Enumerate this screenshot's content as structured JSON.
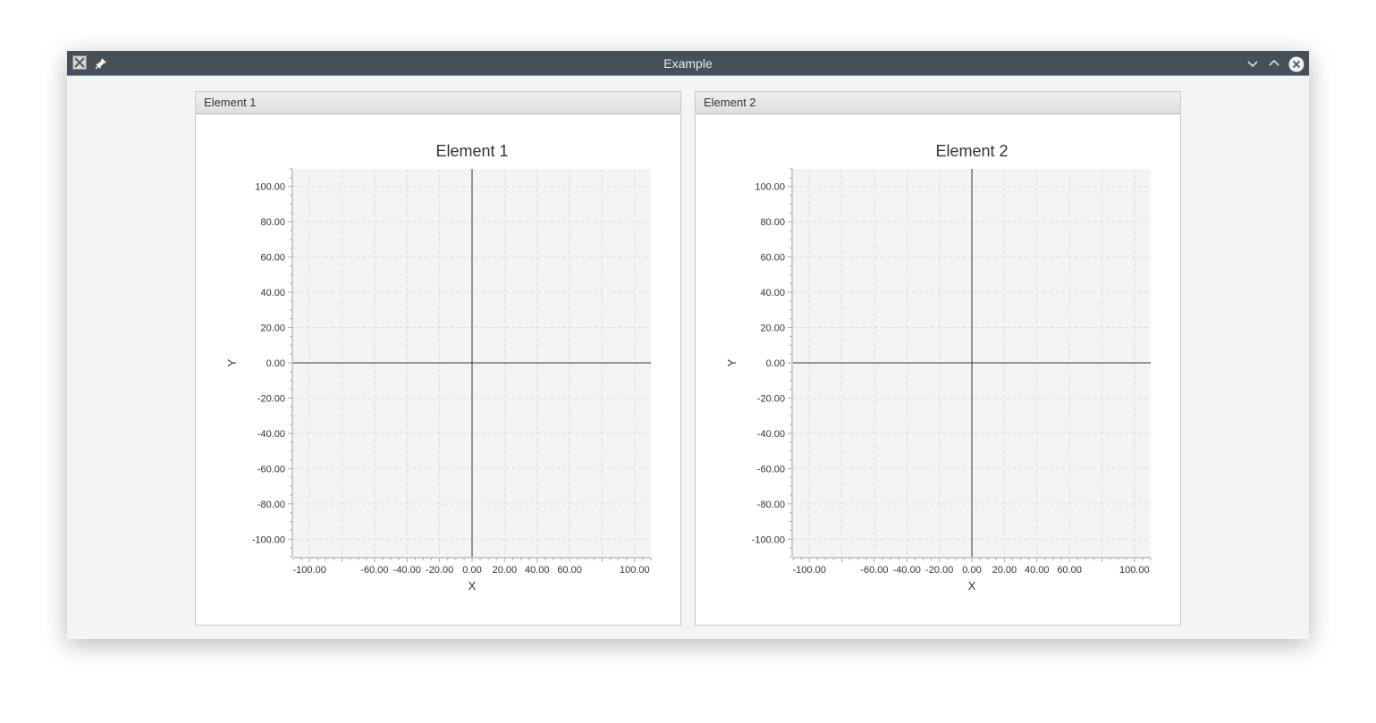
{
  "window": {
    "title": "Example"
  },
  "icons": {
    "app": "x-app-icon",
    "pin": "pin-icon",
    "minimize": "chevron-down-icon",
    "maximize": "chevron-up-icon",
    "close": "close-icon"
  },
  "panels": [
    {
      "header": "Element 1"
    },
    {
      "header": "Element 2"
    }
  ],
  "colors": {
    "titlebar": "#475057",
    "accent": "#3daee9",
    "plot_background": "#f4f4f4",
    "gridline": "#dcdcdc",
    "axis_line": "#333333"
  },
  "chart_data": [
    {
      "type": "scatter",
      "title": "Element 1",
      "xlabel": "X",
      "ylabel": "Y",
      "xlim": [
        -110,
        110
      ],
      "ylim": [
        -110,
        110
      ],
      "x_ticks": [
        "-100.00",
        "-60.00",
        "-40.00",
        "-20.00",
        "0.00",
        "20.00",
        "40.00",
        "60.00",
        "100.00"
      ],
      "y_ticks": [
        "100.00",
        "80.00",
        "60.00",
        "40.00",
        "20.00",
        "0.00",
        "-20.00",
        "-40.00",
        "-60.00",
        "-80.00",
        "-100.00"
      ],
      "grid": true,
      "series": []
    },
    {
      "type": "scatter",
      "title": "Element 2",
      "xlabel": "X",
      "ylabel": "Y",
      "xlim": [
        -110,
        110
      ],
      "ylim": [
        -110,
        110
      ],
      "x_ticks": [
        "-100.00",
        "-60.00",
        "-40.00",
        "-20.00",
        "0.00",
        "20.00",
        "40.00",
        "60.00",
        "100.00"
      ],
      "y_ticks": [
        "100.00",
        "80.00",
        "60.00",
        "40.00",
        "20.00",
        "0.00",
        "-20.00",
        "-40.00",
        "-60.00",
        "-80.00",
        "-100.00"
      ],
      "grid": true,
      "series": []
    }
  ]
}
